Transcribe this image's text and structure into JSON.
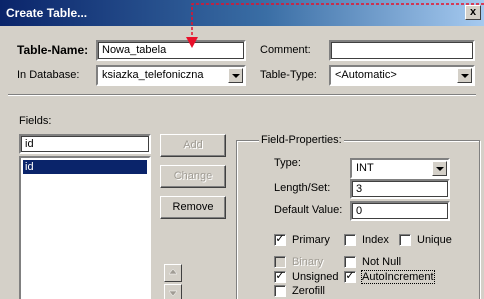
{
  "window": {
    "title": "Create Table...",
    "close_label": "x"
  },
  "table_name": {
    "label": "Table-Name:",
    "value": "Nowa_tabela"
  },
  "comment": {
    "label": "Comment:",
    "value": ""
  },
  "in_database": {
    "label": "In Database:",
    "value": "ksiazka_telefoniczna"
  },
  "table_type": {
    "label": "Table-Type:",
    "value": "<Automatic>"
  },
  "fields": {
    "label": "Fields:",
    "input_value": "id",
    "items": [
      "id"
    ],
    "add_label": "Add",
    "change_label": "Change",
    "remove_label": "Remove"
  },
  "field_properties": {
    "title": "Field-Properties:",
    "type_label": "Type:",
    "type_value": "INT",
    "length_label": "Length/Set:",
    "length_value": "3",
    "default_label": "Default Value:",
    "default_value": "0",
    "checkboxes": [
      {
        "label": "Primary",
        "checked": true,
        "enabled": true
      },
      {
        "label": "Index",
        "checked": false,
        "enabled": true
      },
      {
        "label": "Unique",
        "checked": false,
        "enabled": true
      },
      {
        "label": "Binary",
        "checked": false,
        "enabled": false
      },
      {
        "label": "Not Null",
        "checked": false,
        "enabled": true
      },
      {
        "label": "Unsigned",
        "checked": true,
        "enabled": true
      },
      {
        "label": "AutoIncrement",
        "checked": true,
        "enabled": true
      },
      {
        "label": "Zerofill",
        "checked": false,
        "enabled": true
      }
    ]
  },
  "colors": {
    "titlebar_start": "#0a246a",
    "titlebar_end": "#a6caf0",
    "dialog_face": "#d4d0c8",
    "selection": "#0a246a",
    "annotation": "#e8102a"
  }
}
